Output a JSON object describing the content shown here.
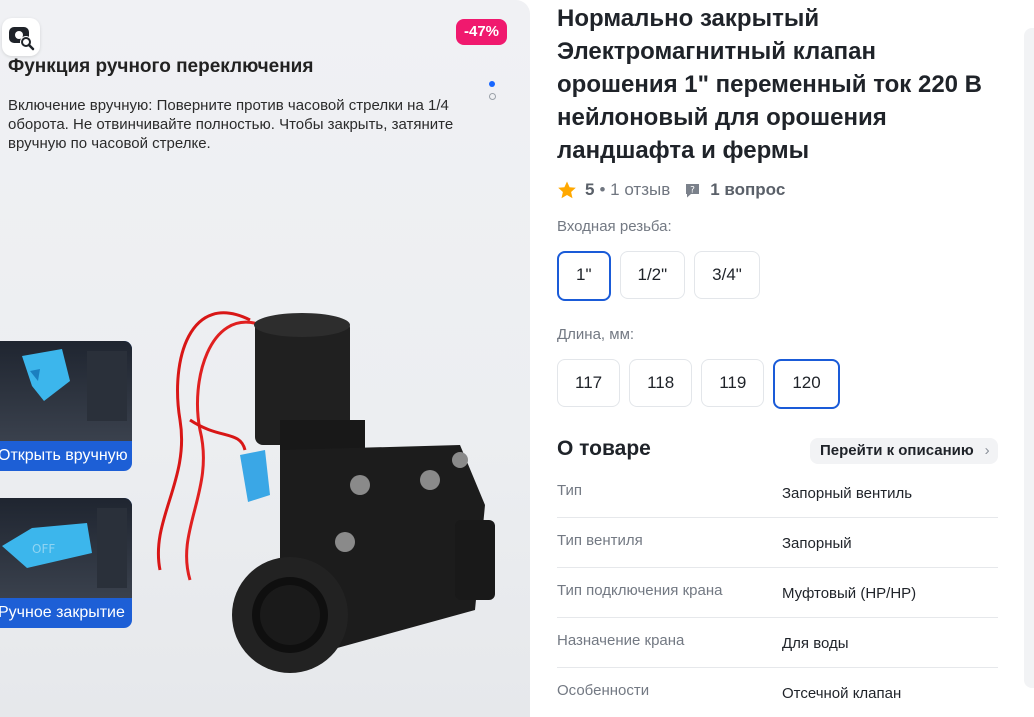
{
  "gallery": {
    "discount": "-47%",
    "heading": "Функция ручного переключения",
    "description": "Включение вручную: Поверните против часовой стрелки на 1/4 оборота. Не отвинчивайте полностью. Чтобы закрыть, затяните вручную по часовой стрелке.",
    "inset_open": "Открыть вручную",
    "inset_close": "Ручное закрытие",
    "valve_label": "OFF",
    "icons": [
      "photo-search-icon",
      "valve-photo"
    ]
  },
  "product": {
    "title": "Нормально закрытый Электромагнитный клапан орошения 1\" переменный ток 220 В нейлоновый для орошения ландшафта и фермы",
    "rating": "5",
    "reviews": "• 1 отзыв",
    "questions": "1 вопрос"
  },
  "thread": {
    "label": "Входная резьба:",
    "options": [
      "1\"",
      "1/2\"",
      "3/4\""
    ],
    "selected": "1\""
  },
  "length": {
    "label": "Длина, мм:",
    "options": [
      "117",
      "118",
      "119",
      "120"
    ],
    "selected": "120"
  },
  "about": {
    "title": "О товаре",
    "goto": "Перейти к описанию",
    "specs": [
      {
        "key": "Тип",
        "value": "Запорный вентиль"
      },
      {
        "key": "Тип вентиля",
        "value": "Запорный"
      },
      {
        "key": "Тип подключения крана",
        "value": "Муфтовый (НР/НР)"
      },
      {
        "key": "Назначение крана",
        "value": "Для воды"
      },
      {
        "key": "Особенности",
        "value": "Отсечной клапан"
      }
    ]
  },
  "colors": {
    "accent": "#1a5bd8",
    "discount": "#f0196e",
    "star": "#ffa800",
    "inset": "#1d5fd6"
  }
}
